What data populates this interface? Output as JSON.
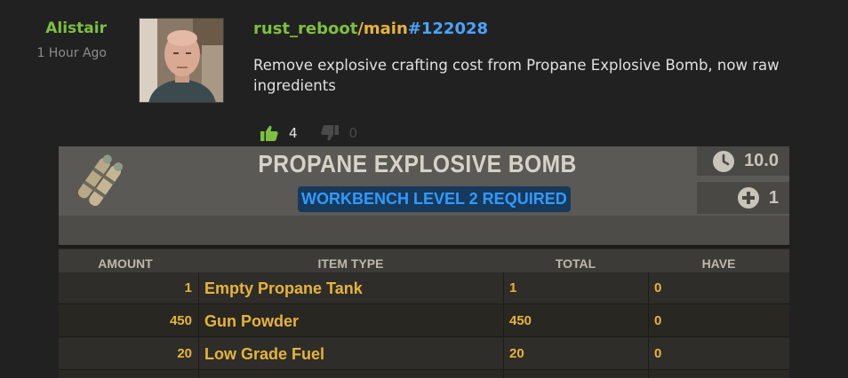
{
  "post": {
    "author": "Alistair",
    "time": "1 Hour Ago",
    "repo": "rust_reboot",
    "branch": "/main",
    "commit": "#122028",
    "message": "Remove explosive crafting cost from Propane Explosive Bomb, now raw ingredients",
    "upvotes": "4",
    "downvotes": "0"
  },
  "card": {
    "title": "PROPANE EXPLOSIVE BOMB",
    "requirement": "WORKBENCH LEVEL 2 REQUIRED",
    "craft_time": "10.0",
    "craft_amount": "1",
    "columns": {
      "amount": "AMOUNT",
      "item_type": "ITEM TYPE",
      "total": "TOTAL",
      "have": "HAVE"
    },
    "rows": [
      {
        "amount": "1",
        "item": "Empty Propane Tank",
        "total": "1",
        "have": "0"
      },
      {
        "amount": "450",
        "item": "Gun Powder",
        "total": "450",
        "have": "0"
      },
      {
        "amount": "20",
        "item": "Low Grade Fuel",
        "total": "20",
        "have": "0"
      }
    ]
  },
  "icons": {
    "upvote": "thumbs-up-icon",
    "downvote": "thumbs-down-icon",
    "time": "clock-icon",
    "amount": "plus-circle-icon"
  },
  "colors": {
    "background": "#212121",
    "author": "#7fbf3f",
    "branch": "#e6b43a",
    "commit": "#4aa3ff",
    "item_text": "#e6b43a",
    "requirement_text": "#2f9bff"
  }
}
